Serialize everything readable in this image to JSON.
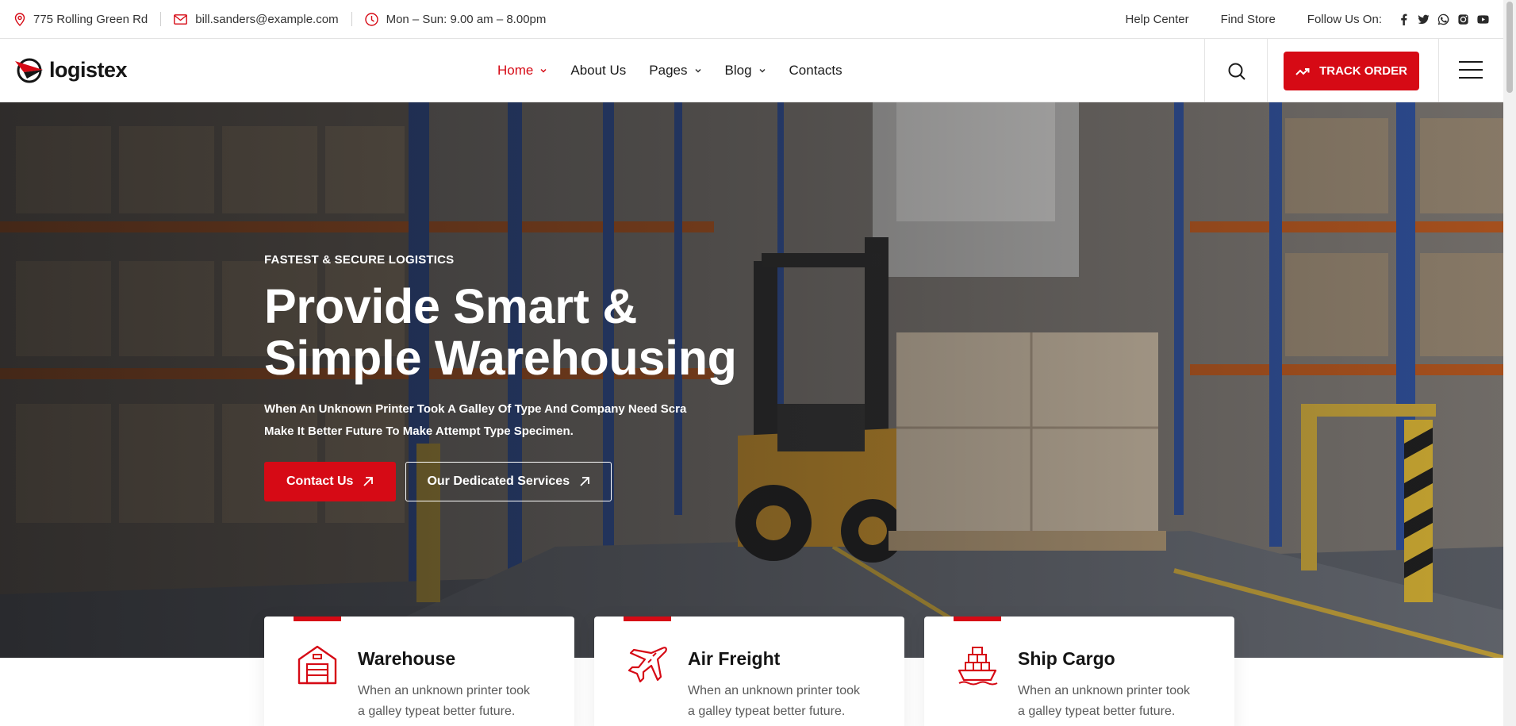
{
  "topbar": {
    "address": "775 Rolling Green Rd",
    "email": "bill.sanders@example.com",
    "hours": "Mon – Sun: 9.00 am – 8.00pm",
    "help_center": "Help Center",
    "find_store": "Find Store",
    "follow_label": "Follow Us On:",
    "social_icons": [
      "facebook-icon",
      "twitter-icon",
      "whatsapp-icon",
      "instagram-icon",
      "youtube-icon"
    ]
  },
  "header": {
    "logo_text": "logistex",
    "nav": [
      {
        "label": "Home",
        "active": true,
        "has_dropdown": true
      },
      {
        "label": "About Us",
        "active": false,
        "has_dropdown": false
      },
      {
        "label": "Pages",
        "active": false,
        "has_dropdown": true
      },
      {
        "label": "Blog",
        "active": false,
        "has_dropdown": true
      },
      {
        "label": "Contacts",
        "active": false,
        "has_dropdown": false
      }
    ],
    "track_label": "TRACK ORDER"
  },
  "hero": {
    "eyebrow": "FASTEST & SECURE LOGISTICS",
    "title_line1": "Provide Smart &",
    "title_line2": "Simple Warehousing",
    "desc_line1": "When An Unknown Printer Took A Galley Of Type And Company Need Scra",
    "desc_line2": "Make It Better Future To Make Attempt Type Specimen.",
    "primary_btn": "Contact Us",
    "secondary_btn": "Our Dedicated Services"
  },
  "services": [
    {
      "title": "Warehouse",
      "desc": "When an unknown printer took a galley typeat better future.",
      "icon": "warehouse-icon"
    },
    {
      "title": "Air Freight",
      "desc": "When an unknown printer took a galley typeat better future.",
      "icon": "airplane-icon"
    },
    {
      "title": "Ship Cargo",
      "desc": "When an unknown printer took a galley typeat better future.",
      "icon": "cargo-ship-icon"
    }
  ],
  "colors": {
    "accent": "#d60a15",
    "text_dark": "#141414",
    "text_muted": "#5b5b5b"
  }
}
